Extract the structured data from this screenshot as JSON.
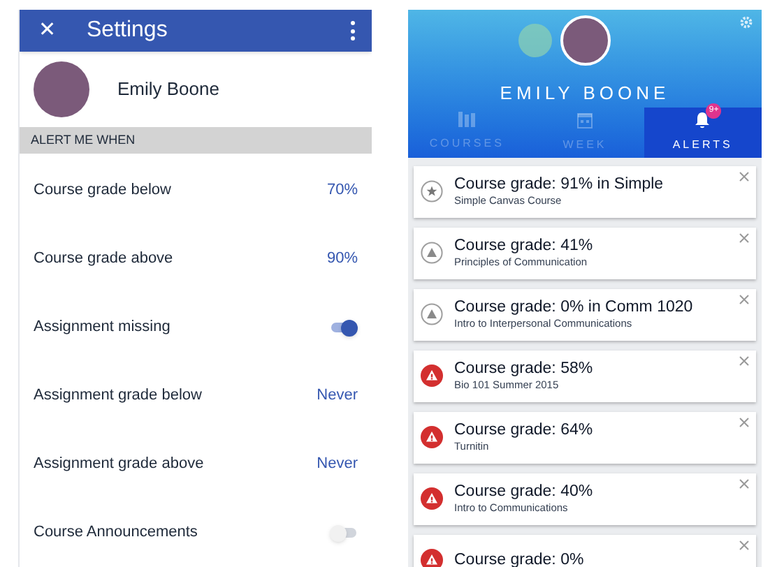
{
  "settings": {
    "title": "Settings",
    "close_icon": "✕",
    "user_name": "Emily Boone",
    "section_header": "ALERT ME WHEN",
    "rows": [
      {
        "kind": "value",
        "label": "Course grade below",
        "value": "70%"
      },
      {
        "kind": "value",
        "label": "Course grade above",
        "value": "90%"
      },
      {
        "kind": "toggle",
        "label": "Assignment missing",
        "on": true
      },
      {
        "kind": "value",
        "label": "Assignment grade below",
        "value": "Never"
      },
      {
        "kind": "value",
        "label": "Assignment grade above",
        "value": "Never"
      },
      {
        "kind": "toggle",
        "label": "Course Announcements",
        "on": false
      }
    ]
  },
  "profile": {
    "name": "EMILY BOONE",
    "tabs": [
      {
        "label": "COURSES",
        "selected": false,
        "kind": "courses"
      },
      {
        "label": "WEEK",
        "selected": false,
        "kind": "week"
      },
      {
        "label": "ALERTS",
        "selected": true,
        "kind": "alerts",
        "badge": "9+"
      }
    ],
    "alerts": [
      {
        "kind": "star",
        "title": "Course grade: 91% in Simple",
        "course": "Simple Canvas Course"
      },
      {
        "kind": "warning",
        "title": "Course grade: 41%",
        "course": "Principles of Communication"
      },
      {
        "kind": "warning",
        "title": "Course grade: 0% in Comm 1020",
        "course": "Intro to Interpersonal Communications"
      },
      {
        "kind": "danger",
        "title": "Course grade: 58%",
        "course": "Bio 101 Summer 2015"
      },
      {
        "kind": "danger",
        "title": "Course grade: 64%",
        "course": "Turnitin"
      },
      {
        "kind": "danger",
        "title": "Course grade: 40%",
        "course": "Intro to Communications"
      },
      {
        "kind": "danger",
        "title": "Course grade: 0%"
      }
    ]
  }
}
